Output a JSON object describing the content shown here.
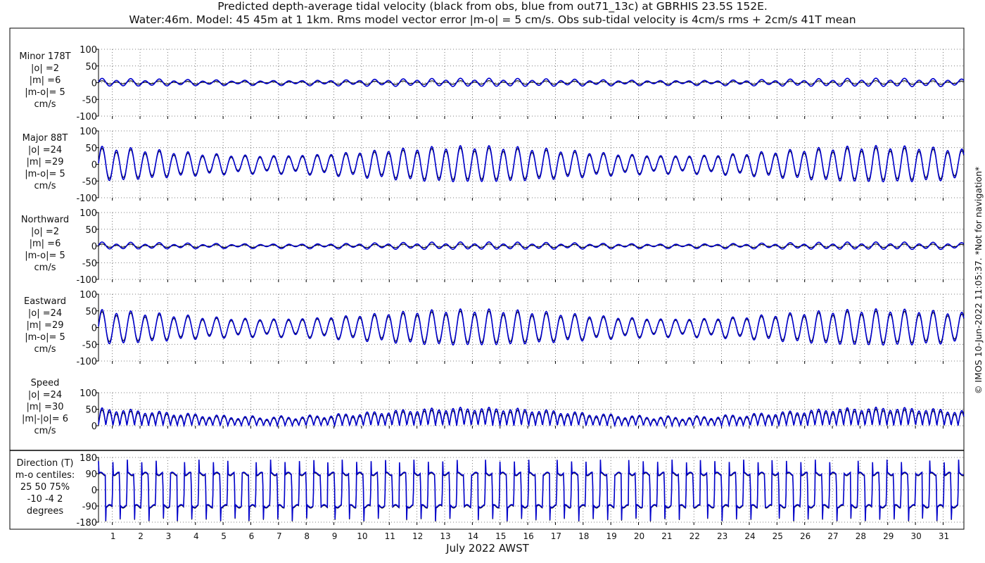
{
  "title": {
    "line1": "Predicted depth-average tidal velocity (black from obs, blue from out71_13c) at GBRHIS 23.5S 152E.",
    "line2": "Water:46m. Model: 45 45m at 1 1km. Rms model vector error |m-o| = 5 cm/s. Obs sub-tidal velocity is 4cm/s rms + 2cm/s 41T mean"
  },
  "copyright": "© IMOS 10-Jun-2022 11:05:37. *Not for navigation*",
  "colors": {
    "obs": "#000000",
    "model": "#0000cc",
    "grid": "#555555",
    "axis": "#000000"
  },
  "chart_data": [
    {
      "type": "line",
      "label_lines": [
        "Minor 178T",
        "|o| =2",
        "|m| =6",
        "|m-o|= 5",
        "cm/s"
      ],
      "ylim": [
        -100,
        100
      ],
      "yticks": [
        -100,
        -50,
        0,
        50,
        100
      ],
      "series": [
        {
          "name": "black from obs",
          "color": "#000000",
          "mean": 0,
          "amp_semidiurnal": 3,
          "amp_diurnal": 2,
          "spring_mod": 0.3
        },
        {
          "name": "blue from out71_13c",
          "color": "#0000cc",
          "mean": 0,
          "amp_semidiurnal": 8,
          "amp_diurnal": 3,
          "spring_mod": 0.3
        }
      ]
    },
    {
      "type": "line",
      "label_lines": [
        "Major 88T",
        "|o| =24",
        "|m| =29",
        "|m-o|= 5",
        "cm/s"
      ],
      "ylim": [
        -100,
        100
      ],
      "yticks": [
        -100,
        -50,
        0,
        50,
        100
      ],
      "series": [
        {
          "name": "black from obs",
          "color": "#000000",
          "mean": 0,
          "amp_semidiurnal": 33,
          "amp_diurnal": 5,
          "spring_mod": 0.35
        },
        {
          "name": "blue from out71_13c",
          "color": "#0000cc",
          "mean": 0,
          "amp_semidiurnal": 38,
          "amp_diurnal": 5,
          "spring_mod": 0.35
        }
      ]
    },
    {
      "type": "line",
      "label_lines": [
        "Northward",
        "|o| =2",
        "|m| =6",
        "|m-o|= 5",
        "cm/s"
      ],
      "ylim": [
        -100,
        100
      ],
      "yticks": [
        -100,
        -50,
        0,
        50,
        100
      ],
      "series": [
        {
          "name": "black from obs",
          "color": "#000000",
          "mean": 0,
          "amp_semidiurnal": 3,
          "amp_diurnal": 2,
          "spring_mod": 0.3
        },
        {
          "name": "blue from out71_13c",
          "color": "#0000cc",
          "mean": 0,
          "amp_semidiurnal": 7,
          "amp_diurnal": 3,
          "spring_mod": 0.3
        }
      ]
    },
    {
      "type": "line",
      "label_lines": [
        "Eastward",
        "|o| =24",
        "|m| =29",
        "|m-o|= 5",
        "cm/s"
      ],
      "ylim": [
        -100,
        100
      ],
      "yticks": [
        -100,
        -50,
        0,
        50,
        100
      ],
      "series": [
        {
          "name": "black from obs",
          "color": "#000000",
          "mean": 0,
          "amp_semidiurnal": 33,
          "amp_diurnal": 5,
          "spring_mod": 0.35
        },
        {
          "name": "blue from out71_13c",
          "color": "#0000cc",
          "mean": 0,
          "amp_semidiurnal": 38,
          "amp_diurnal": 5,
          "spring_mod": 0.35
        }
      ]
    },
    {
      "type": "line",
      "label_lines": [
        "Speed",
        "|o| =24",
        "|m| =30",
        "|m|-|o|= 6",
        "cm/s"
      ],
      "ylim": [
        0,
        100
      ],
      "yticks": [
        0,
        50,
        100
      ],
      "series": [
        {
          "name": "black from obs",
          "color": "#000000",
          "mean": 0,
          "amp_semidiurnal": 33,
          "amp_diurnal": 5,
          "spring_mod": 0.35,
          "abs": true
        },
        {
          "name": "blue from out71_13c",
          "color": "#0000cc",
          "mean": 0,
          "amp_semidiurnal": 38,
          "amp_diurnal": 5,
          "spring_mod": 0.35,
          "abs": true
        }
      ]
    },
    {
      "type": "line",
      "label_lines": [
        "Direction (T)",
        "m-o centiles:",
        "25  50  75%",
        "-10  -4   2",
        "degrees"
      ],
      "ylim": [
        -180,
        180
      ],
      "yticks": [
        -180,
        -90,
        0,
        90,
        180
      ],
      "series": [
        {
          "name": "black from obs",
          "color": "#000000",
          "direction": true,
          "offset": -4
        },
        {
          "name": "blue from out71_13c",
          "color": "#0000cc",
          "direction": true,
          "offset": 0
        }
      ]
    }
  ],
  "x_axis": {
    "label": "July 2022 AWST",
    "ticks": [
      "1",
      "2",
      "3",
      "4",
      "5",
      "6",
      "7",
      "8",
      "9",
      "10",
      "11",
      "12",
      "13",
      "14",
      "15",
      "16",
      "17",
      "18",
      "19",
      "20",
      "21",
      "22",
      "23",
      "24",
      "25",
      "26",
      "27",
      "28",
      "29",
      "30",
      "31"
    ],
    "range_days": [
      0,
      31.25
    ]
  }
}
